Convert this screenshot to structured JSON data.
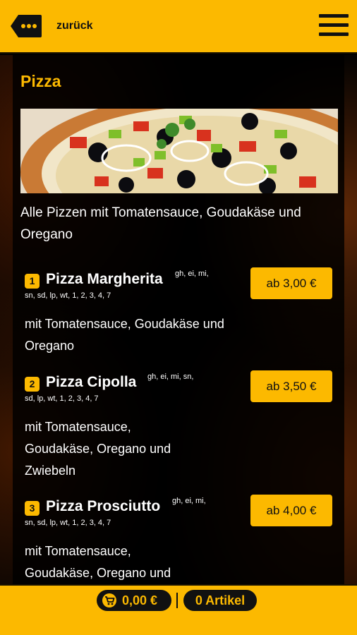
{
  "header": {
    "back_label": "zurück",
    "back_icon": "ellipsis-tag-icon",
    "menu_icon": "hamburger-menu-icon"
  },
  "section": {
    "title": "Pizza",
    "image": "pizza-photo",
    "intro": "Alle Pizzen mit Tomatensauce, Goudakäse und Oregano"
  },
  "items": [
    {
      "number": "1",
      "name": "Pizza Margherita",
      "allergens_line1": "gh, ei, mi,",
      "allergens_line2": "sn, sd, lp, wt, 1, 2, 3, 4, 7",
      "price": "ab 3,00 €",
      "description": "mit Tomatensauce, Goudakäse und Oregano"
    },
    {
      "number": "2",
      "name": "Pizza Cipolla",
      "allergens_line1": "gh, ei, mi, sn,",
      "allergens_line2": "sd, lp, wt, 1, 2, 3, 4, 7",
      "price": "ab 3,50 €",
      "description": "mit Tomatensauce, Goudakäse, Oregano und Zwiebeln"
    },
    {
      "number": "3",
      "name": "Pizza Prosciutto",
      "allergens_line1": "gh, ei, mi,",
      "allergens_line2": "sn, sd, lp, wt, 1, 2, 3, 4, 7",
      "price": "ab 4,00 €",
      "description": "mit Tomatensauce, Goudakäse, Oregano und"
    }
  ],
  "footer": {
    "cart_total": "0,00 €",
    "cart_icon": "shopping-cart-icon",
    "item_count": "0 Artikel"
  },
  "colors": {
    "accent": "#fcb900",
    "background": "#000000",
    "text": "#ffffff"
  }
}
